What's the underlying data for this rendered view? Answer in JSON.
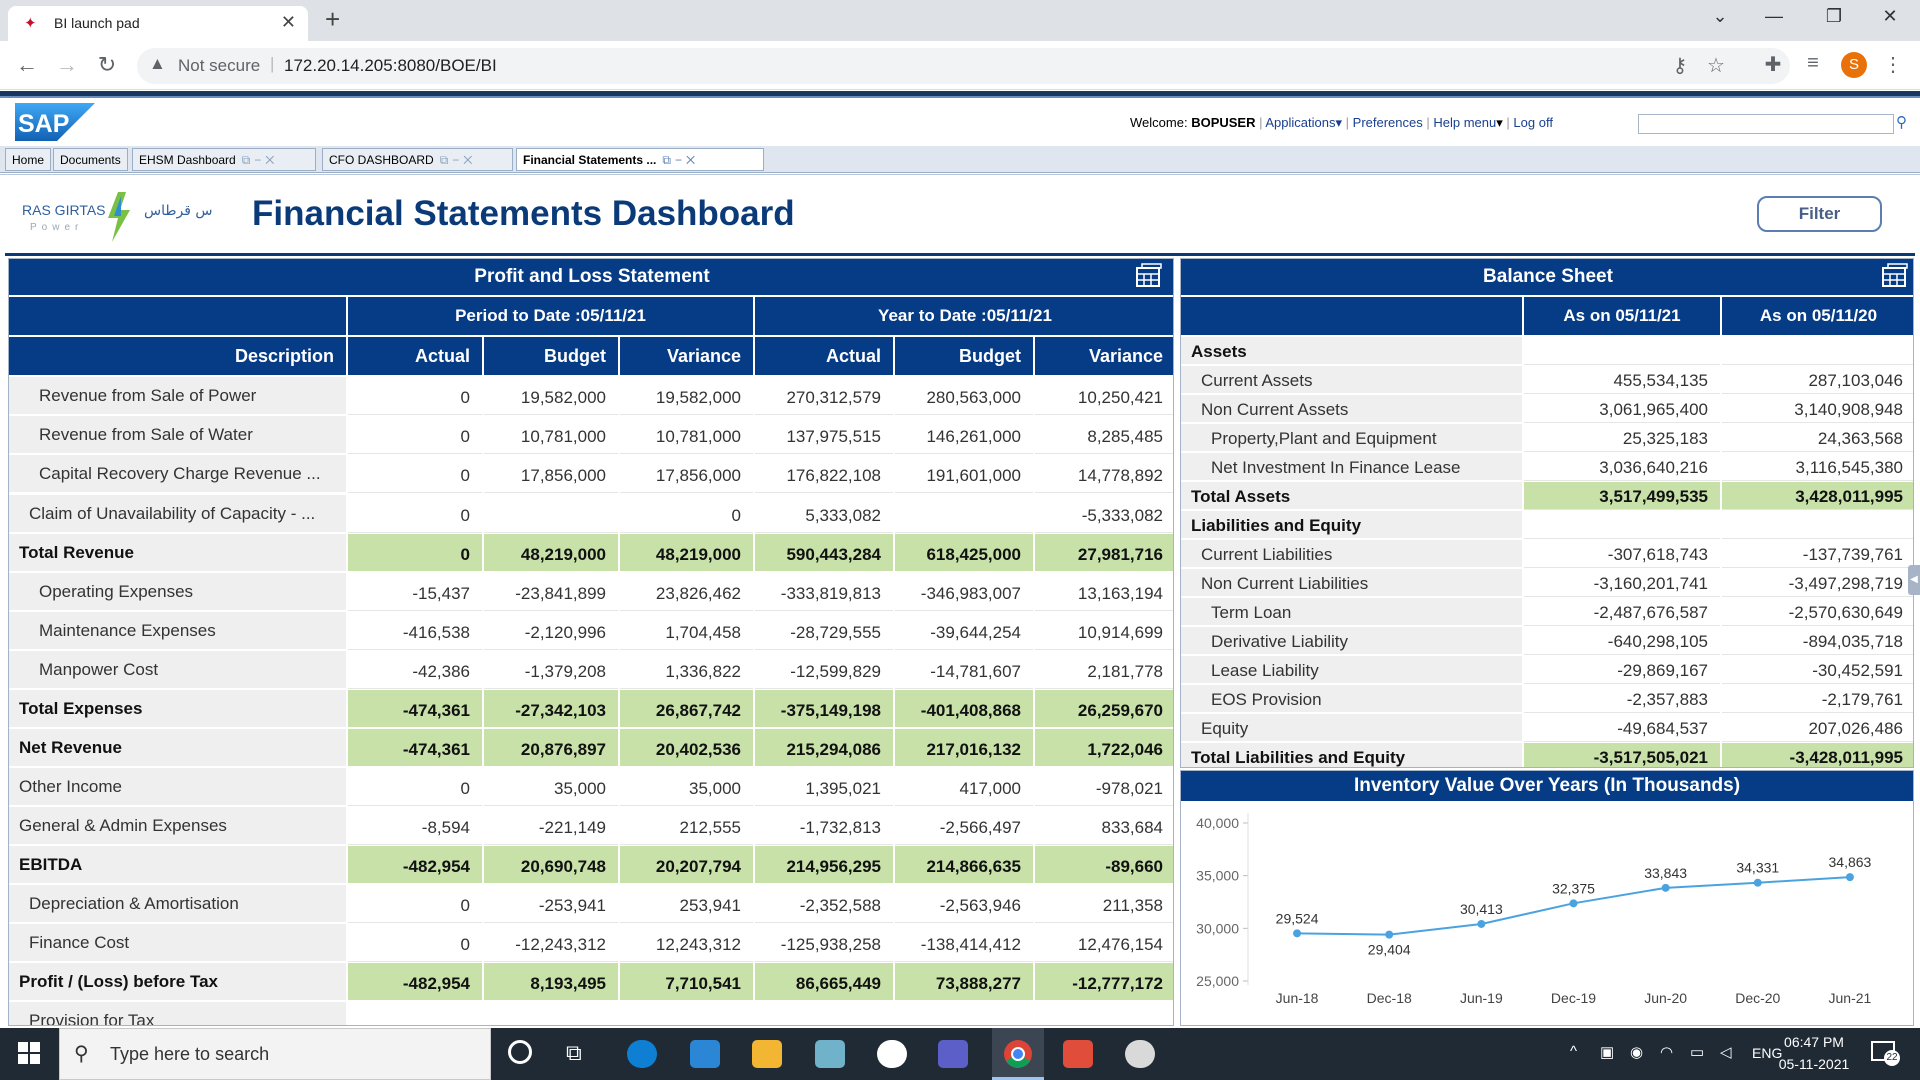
{
  "browser": {
    "tab_title": "BI launch pad",
    "security": "Not secure",
    "url": "172.20.14.205:8080/BOE/BI",
    "profile_initial": "S"
  },
  "boe": {
    "welcome_label": "Welcome:",
    "user": "BOPUSER",
    "menu": [
      "Applications",
      "Preferences",
      "Help menu",
      "Log off"
    ],
    "tabs": [
      "Home",
      "Documents",
      "EHSM Dashboard",
      "CFO DASHBOARD",
      "Financial Statements ..."
    ]
  },
  "dashboard": {
    "title": "Financial Statements Dashboard",
    "brand_en": "RAS GIRTAS",
    "brand_sub": "Power",
    "brand_ar": "رأس قرطاس",
    "filter_label": "Filter"
  },
  "pl": {
    "title": "Profit and Loss Statement",
    "period_to_date": "Period to Date :05/11/21",
    "year_to_date": "Year to Date :05/11/21",
    "columns": [
      "Description",
      "Actual",
      "Budget",
      "Variance",
      "Actual",
      "Budget",
      "Variance"
    ],
    "rows": [
      {
        "desc": "Revenue from Sale of Power",
        "level": 1,
        "total": false,
        "vals": [
          "0",
          "19,582,000",
          "19,582,000",
          "270,312,579",
          "280,563,000",
          "10,250,421"
        ]
      },
      {
        "desc": "Revenue from Sale of Water",
        "level": 1,
        "total": false,
        "vals": [
          "0",
          "10,781,000",
          "10,781,000",
          "137,975,515",
          "146,261,000",
          "8,285,485"
        ]
      },
      {
        "desc": "Capital Recovery Charge Revenue ...",
        "level": 1,
        "total": false,
        "vals": [
          "0",
          "17,856,000",
          "17,856,000",
          "176,822,108",
          "191,601,000",
          "14,778,892"
        ]
      },
      {
        "desc": "Claim of Unavailability of Capacity - ...",
        "level": 2,
        "total": false,
        "vals": [
          "0",
          "",
          "0",
          "5,333,082",
          "",
          "-5,333,082"
        ]
      },
      {
        "desc": "Total Revenue",
        "level": 0,
        "total": true,
        "vals": [
          "0",
          "48,219,000",
          "48,219,000",
          "590,443,284",
          "618,425,000",
          "27,981,716"
        ]
      },
      {
        "desc": "Operating Expenses",
        "level": 1,
        "total": false,
        "vals": [
          "-15,437",
          "-23,841,899",
          "23,826,462",
          "-333,819,813",
          "-346,983,007",
          "13,163,194"
        ]
      },
      {
        "desc": "Maintenance Expenses",
        "level": 1,
        "total": false,
        "vals": [
          "-416,538",
          "-2,120,996",
          "1,704,458",
          "-28,729,555",
          "-39,644,254",
          "10,914,699"
        ]
      },
      {
        "desc": "Manpower Cost",
        "level": 1,
        "total": false,
        "vals": [
          "-42,386",
          "-1,379,208",
          "1,336,822",
          "-12,599,829",
          "-14,781,607",
          "2,181,778"
        ]
      },
      {
        "desc": "Total Expenses",
        "level": 0,
        "total": true,
        "vals": [
          "-474,361",
          "-27,342,103",
          "26,867,742",
          "-375,149,198",
          "-401,408,868",
          "26,259,670"
        ]
      },
      {
        "desc": "Net Revenue",
        "level": 0,
        "total": true,
        "vals": [
          "-474,361",
          "20,876,897",
          "20,402,536",
          "215,294,086",
          "217,016,132",
          "1,722,046"
        ]
      },
      {
        "desc": "Other Income",
        "level": 0,
        "total": false,
        "vals": [
          "0",
          "35,000",
          "35,000",
          "1,395,021",
          "417,000",
          "-978,021"
        ]
      },
      {
        "desc": "General & Admin Expenses",
        "level": 0,
        "total": false,
        "vals": [
          "-8,594",
          "-221,149",
          "212,555",
          "-1,732,813",
          "-2,566,497",
          "833,684"
        ]
      },
      {
        "desc": "EBITDA",
        "level": 0,
        "total": true,
        "vals": [
          "-482,954",
          "20,690,748",
          "20,207,794",
          "214,956,295",
          "214,866,635",
          "-89,660"
        ]
      },
      {
        "desc": "Depreciation & Amortisation",
        "level": 2,
        "total": false,
        "vals": [
          "0",
          "-253,941",
          "253,941",
          "-2,352,588",
          "-2,563,946",
          "211,358"
        ]
      },
      {
        "desc": "Finance Cost",
        "level": 2,
        "total": false,
        "vals": [
          "0",
          "-12,243,312",
          "12,243,312",
          "-125,938,258",
          "-138,414,412",
          "12,476,154"
        ]
      },
      {
        "desc": "Profit / (Loss) before Tax",
        "level": 0,
        "total": true,
        "vals": [
          "-482,954",
          "8,193,495",
          "7,710,541",
          "86,665,449",
          "73,888,277",
          "-12,777,172"
        ]
      },
      {
        "desc": "Provision for Tax",
        "level": 2,
        "total": false,
        "vals": [
          "",
          "",
          "",
          "",
          "",
          ""
        ]
      }
    ]
  },
  "bs": {
    "title": "Balance Sheet",
    "col1": "As on 05/11/21",
    "col2": "As on 05/11/20",
    "rows": [
      {
        "desc": "Assets",
        "level": 0,
        "kind": "sec",
        "v1": "",
        "v2": ""
      },
      {
        "desc": "Current Assets",
        "level": 1,
        "kind": "",
        "v1": "455,534,135",
        "v2": "287,103,046"
      },
      {
        "desc": "Non Current Assets",
        "level": 1,
        "kind": "",
        "v1": "3,061,965,400",
        "v2": "3,140,908,948"
      },
      {
        "desc": "Property,Plant and Equipment",
        "level": 2,
        "kind": "",
        "v1": "25,325,183",
        "v2": "24,363,568"
      },
      {
        "desc": "Net Investment In Finance Lease",
        "level": 2,
        "kind": "",
        "v1": "3,036,640,216",
        "v2": "3,116,545,380"
      },
      {
        "desc": "Total Assets",
        "level": 0,
        "kind": "tot",
        "v1": "3,517,499,535",
        "v2": "3,428,011,995"
      },
      {
        "desc": "Liabilities and Equity",
        "level": 0,
        "kind": "sec",
        "v1": "",
        "v2": ""
      },
      {
        "desc": "Current Liabilities",
        "level": 1,
        "kind": "",
        "v1": "-307,618,743",
        "v2": "-137,739,761"
      },
      {
        "desc": "Non Current Liabilities",
        "level": 1,
        "kind": "",
        "v1": "-3,160,201,741",
        "v2": "-3,497,298,719"
      },
      {
        "desc": "Term Loan",
        "level": 2,
        "kind": "",
        "v1": "-2,487,676,587",
        "v2": "-2,570,630,649"
      },
      {
        "desc": "Derivative Liability",
        "level": 2,
        "kind": "",
        "v1": "-640,298,105",
        "v2": "-894,035,718"
      },
      {
        "desc": "Lease Liability",
        "level": 2,
        "kind": "",
        "v1": "-29,869,167",
        "v2": "-30,452,591"
      },
      {
        "desc": "EOS Provision",
        "level": 2,
        "kind": "",
        "v1": "-2,357,883",
        "v2": "-2,179,761"
      },
      {
        "desc": "Equity",
        "level": 1,
        "kind": "",
        "v1": "-49,684,537",
        "v2": "207,026,486"
      },
      {
        "desc": "Total Liabilities and Equity",
        "level": 0,
        "kind": "tot",
        "v1": "-3,517,505,021",
        "v2": "-3,428,011,995"
      }
    ]
  },
  "chart_data": {
    "type": "line",
    "title": "Inventory Value Over Years (In Thousands)",
    "categories": [
      "Jun-18",
      "Dec-18",
      "Jun-19",
      "Dec-19",
      "Jun-20",
      "Dec-20",
      "Jun-21"
    ],
    "values": [
      29524,
      29404,
      30413,
      32375,
      33843,
      34331,
      34863
    ],
    "value_labels": [
      "29,524",
      "29,404",
      "30,413",
      "32,375",
      "33,843",
      "34,331",
      "34,863"
    ],
    "yticks": [
      "25,000",
      "30,000",
      "35,000",
      "40,000"
    ],
    "ylim": [
      25000,
      40000
    ],
    "color": "#4aa3e0"
  },
  "taskbar": {
    "search_placeholder": "Type here to search",
    "lang": "ENG",
    "time": "06:47 PM",
    "date": "05-11-2021",
    "notif_count": "22"
  }
}
